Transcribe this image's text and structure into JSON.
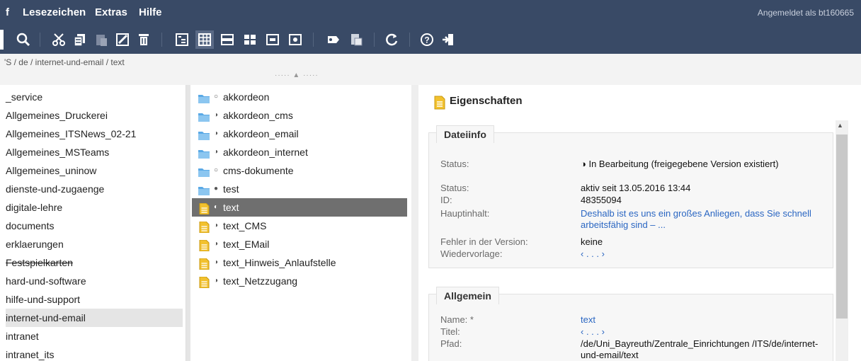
{
  "menu": {
    "items": [
      "f",
      "Lesezeichen",
      "Extras",
      "Hilfe"
    ],
    "user_label": "Angemeldet als bt160665"
  },
  "toolbar": {
    "icons": [
      "search-icon",
      "cut-icon",
      "copy-icon",
      "paste-icon",
      "rename-icon",
      "delete-icon",
      "layout-tree-icon",
      "layout-grid-icon",
      "layout-rows-icon",
      "layout-columns-icon",
      "layout-panel-icon",
      "preview-icon",
      "tag-icon",
      "export-icon",
      "refresh-icon",
      "help-icon",
      "logout-icon"
    ]
  },
  "breadcrumb": "'S / de / internet-und-email / text",
  "col1": {
    "items": [
      "_service",
      "Allgemeines_Druckerei",
      "Allgemeines_ITSNews_02-21",
      "Allgemeines_MSTeams",
      "Allgemeines_uninow",
      "dienste-und-zugaenge",
      "digitale-lehre",
      "documents",
      "erklaerungen",
      "Festspielkarten",
      "hard-und-software",
      "hilfe-und-support",
      "internet-und-email",
      "intranet",
      "intranet_its"
    ],
    "selected": "internet-und-email",
    "strikethrough": [
      "Festspielkarten"
    ]
  },
  "col2": {
    "items": [
      {
        "name": "akkordeon",
        "type": "folder",
        "state": "○"
      },
      {
        "name": "akkordeon_cms",
        "type": "folder",
        "state": "◑"
      },
      {
        "name": "akkordeon_email",
        "type": "folder",
        "state": "◑"
      },
      {
        "name": "akkordeon_internet",
        "type": "folder",
        "state": "◑"
      },
      {
        "name": "cms-dokumente",
        "type": "folder",
        "state": "○"
      },
      {
        "name": "test",
        "type": "folder",
        "state": "●"
      },
      {
        "name": "text",
        "type": "doc",
        "state": "◐"
      },
      {
        "name": "text_CMS",
        "type": "doc",
        "state": "◑"
      },
      {
        "name": "text_EMail",
        "type": "doc",
        "state": "◑"
      },
      {
        "name": "text_Hinweis_Anlaufstelle",
        "type": "doc",
        "state": "◑"
      },
      {
        "name": "text_Netzzugang",
        "type": "doc",
        "state": "◑"
      }
    ],
    "selected": "text"
  },
  "props": {
    "title": "Eigenschaften",
    "dateiinfo": {
      "legend": "Dateiinfo",
      "rows": [
        {
          "label": "Status:",
          "value": "◑ In Bearbeitung (freigegebene Version existiert)",
          "link": false
        },
        {
          "label": "Status:",
          "value": "aktiv seit 13.05.2016 13:44",
          "link": false
        },
        {
          "label": "ID:",
          "value": "48355094",
          "link": false
        },
        {
          "label": "Hauptinhalt:",
          "value": "Deshalb ist es uns ein großes Anliegen, dass Sie schnell arbeitsfähig sind – ...",
          "link": true
        },
        {
          "label": "Fehler in der Version:",
          "value": "keine",
          "link": false
        },
        {
          "label": "Wiedervorlage:",
          "value": "‹ . . . ›",
          "link": true
        }
      ]
    },
    "allgemein": {
      "legend": "Allgemein",
      "rows": [
        {
          "label": "Name: *",
          "value": "text",
          "link": true
        },
        {
          "label": "Titel:",
          "value": "‹ . . . ›",
          "link": true
        },
        {
          "label": "Pfad:",
          "value": "/de/Uni_Bayreuth/Zentrale_Einrichtungen /ITS/de/internet-und-email/text",
          "link": false
        }
      ]
    }
  },
  "colors": {
    "header_bg": "#394a66",
    "selected_bg": "#6f6f6f",
    "link": "#2a66c2",
    "folder": "#5aa9e6",
    "doc": "#f2c12e"
  }
}
